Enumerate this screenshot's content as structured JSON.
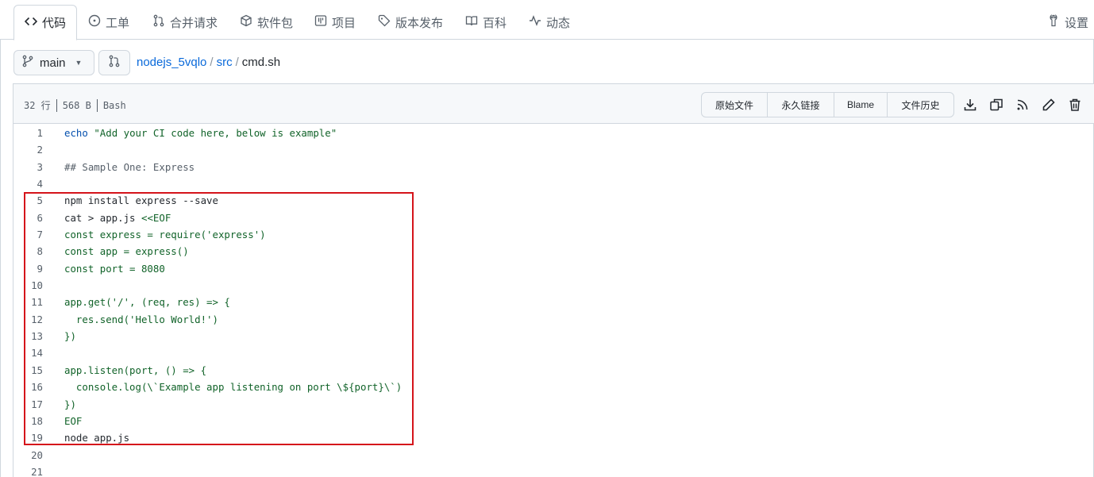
{
  "tabs": [
    {
      "label": "代码",
      "icon": "code-icon",
      "active": true
    },
    {
      "label": "工单",
      "icon": "issue-icon"
    },
    {
      "label": "合并请求",
      "icon": "pull-request-icon"
    },
    {
      "label": "软件包",
      "icon": "package-icon"
    },
    {
      "label": "项目",
      "icon": "project-icon"
    },
    {
      "label": "版本发布",
      "icon": "tag-icon"
    },
    {
      "label": "百科",
      "icon": "book-icon"
    },
    {
      "label": "动态",
      "icon": "pulse-icon"
    }
  ],
  "settings_label": "设置",
  "branch": {
    "name": "main"
  },
  "breadcrumb": {
    "repo": "nodejs_5vqlo",
    "dir": "src",
    "sep": "/",
    "file": "cmd.sh"
  },
  "file_meta": {
    "lines": "32 行",
    "size": "568 B",
    "lang": "Bash"
  },
  "actions": {
    "raw": "原始文件",
    "permalink": "永久链接",
    "blame": "Blame",
    "history": "文件历史"
  },
  "action_icons": [
    "download-icon",
    "copy-icon",
    "rss-icon",
    "edit-icon",
    "delete-icon"
  ],
  "code_lines": [
    {
      "n": "1",
      "parts": [
        [
          "kw",
          "echo"
        ],
        [
          "plain",
          " "
        ],
        [
          "str",
          "\"Add your CI code here, below is example\""
        ]
      ]
    },
    {
      "n": "2",
      "parts": []
    },
    {
      "n": "3",
      "parts": [
        [
          "cmt",
          "## Sample One: Express"
        ]
      ]
    },
    {
      "n": "4",
      "parts": []
    },
    {
      "n": "5",
      "parts": [
        [
          "plain",
          "npm install express --save"
        ]
      ]
    },
    {
      "n": "6",
      "parts": [
        [
          "plain",
          "cat > app.js "
        ],
        [
          "green",
          "<<EOF"
        ]
      ]
    },
    {
      "n": "7",
      "parts": [
        [
          "green",
          "const express = require('express')"
        ]
      ]
    },
    {
      "n": "8",
      "parts": [
        [
          "green",
          "const app = express()"
        ]
      ]
    },
    {
      "n": "9",
      "parts": [
        [
          "green",
          "const port = 8080"
        ]
      ]
    },
    {
      "n": "10",
      "parts": []
    },
    {
      "n": "11",
      "parts": [
        [
          "green",
          "app.get('/', (req, res) => {"
        ]
      ]
    },
    {
      "n": "12",
      "parts": [
        [
          "green",
          "  res.send('Hello World!')"
        ]
      ]
    },
    {
      "n": "13",
      "parts": [
        [
          "green",
          "})"
        ]
      ]
    },
    {
      "n": "14",
      "parts": []
    },
    {
      "n": "15",
      "parts": [
        [
          "green",
          "app.listen(port, () => {"
        ]
      ]
    },
    {
      "n": "16",
      "parts": [
        [
          "green",
          "  console.log(\\`Example app listening on port \\${port}\\`)"
        ]
      ]
    },
    {
      "n": "17",
      "parts": [
        [
          "green",
          "})"
        ]
      ]
    },
    {
      "n": "18",
      "parts": [
        [
          "green",
          "EOF"
        ]
      ]
    },
    {
      "n": "19",
      "parts": [
        [
          "plain",
          "node app.js"
        ]
      ]
    },
    {
      "n": "20",
      "parts": []
    },
    {
      "n": "21",
      "parts": []
    }
  ],
  "colors": {
    "highlight_border": "#d5141b",
    "link": "#0969da"
  }
}
